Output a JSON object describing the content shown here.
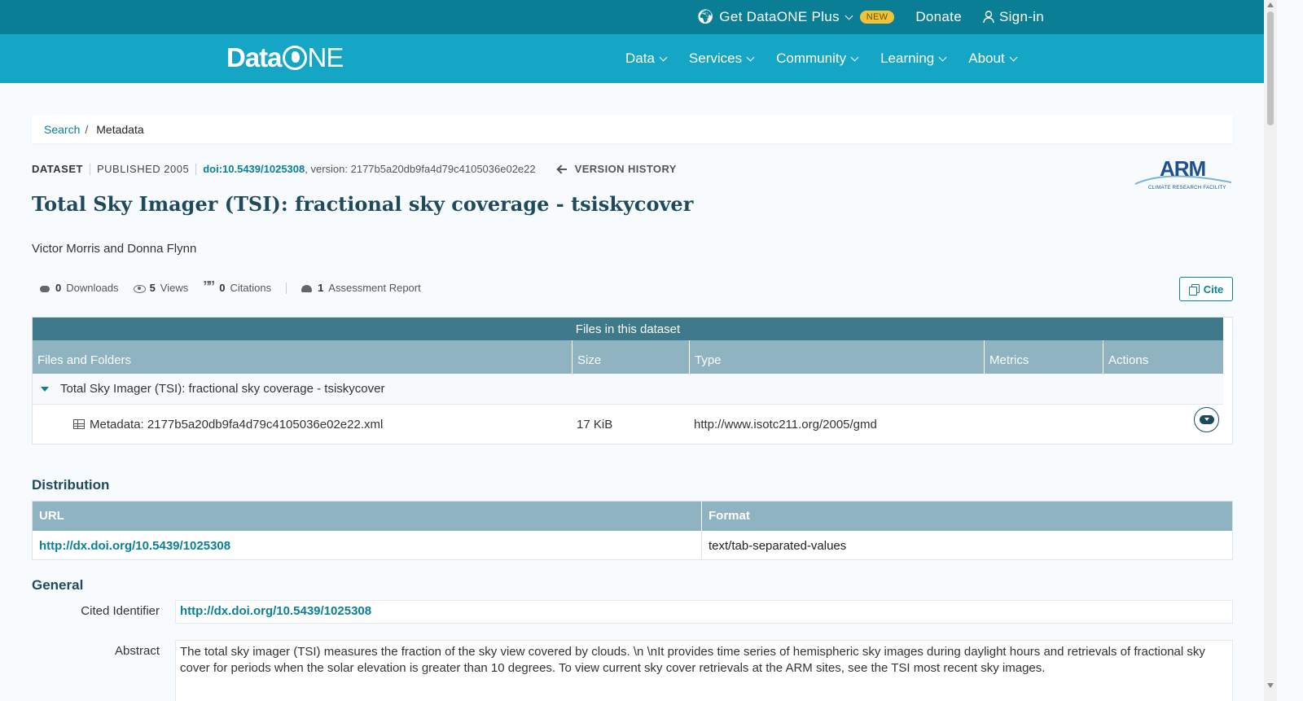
{
  "topbar": {
    "plus_label": "Get DataONE Plus",
    "new_badge": "NEW",
    "donate_label": "Donate",
    "signin_label": "Sign-in"
  },
  "navbar": {
    "logo_data": "Data",
    "logo_ne": "NE",
    "items": [
      "Data",
      "Services",
      "Community",
      "Learning",
      "About"
    ]
  },
  "breadcrumb": {
    "search": "Search",
    "sep": "/",
    "current": "Metadata"
  },
  "dataset": {
    "type_label": "DATASET",
    "published": "PUBLISHED 2005",
    "doi": "doi:10.5439/1025308",
    "version": ", version: 2177b5a20db9fa4d79c4105036e02e22",
    "version_history": "VERSION HISTORY",
    "title": "Total Sky Imager (TSI): fractional sky coverage - tsiskycover",
    "authors": "Victor Morris and Donna Flynn"
  },
  "arm_logo": {
    "name": "ARM",
    "sub": "CLIMATE RESEARCH FACILITY"
  },
  "stats": {
    "downloads_n": "0",
    "downloads_label": "Downloads",
    "views_n": "5",
    "views_label": "Views",
    "citations_n": "0",
    "citations_label": "Citations",
    "assessment_n": "1",
    "assessment_label": "Assessment Report"
  },
  "cite_label": "Cite",
  "files": {
    "header": "Files in this dataset",
    "columns": [
      "Files and Folders",
      "Size",
      "Type",
      "Metrics",
      "Actions"
    ],
    "folder": "Total Sky Imager (TSI): fractional sky coverage - tsiskycover",
    "file_name": "Metadata: 2177b5a20db9fa4d79c4105036e02e22.xml",
    "file_size": "17 KiB",
    "file_type": "http://www.isotc211.org/2005/gmd"
  },
  "distribution": {
    "heading": "Distribution",
    "col_url": "URL",
    "col_format": "Format",
    "url": "http://dx.doi.org/10.5439/1025308",
    "format": "text/tab-separated-values"
  },
  "general": {
    "heading": "General",
    "cited_label": "Cited Identifier",
    "cited_value": "http://dx.doi.org/10.5439/1025308",
    "abstract_label": "Abstract",
    "abstract_value": "The total sky imager (TSI) measures the fraction of the sky view covered by clouds. \\n \\nIt provides time series of hemispheric sky images during daylight hours and retrievals of fractional sky cover for periods when the solar elevation is greater than 10 degrees. To view current sky cover retrievals at the ARM sites, see the TSI most recent sky images."
  }
}
